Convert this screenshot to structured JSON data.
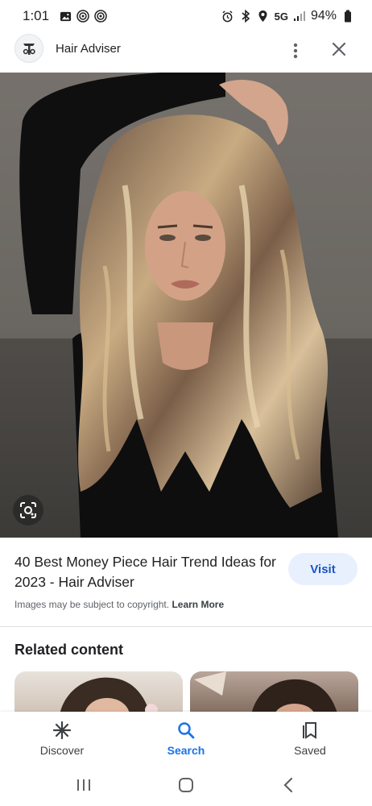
{
  "status_bar": {
    "time": "1:01",
    "network": "5G",
    "battery": "94%",
    "icons_left": [
      "image-icon",
      "nfc-icon",
      "nfc-icon"
    ],
    "icons_right": [
      "alarm-icon",
      "bluetooth-icon",
      "location-icon",
      "signal-icon",
      "battery-icon"
    ]
  },
  "header": {
    "site_name": "Hair Adviser",
    "logo_icon": "site-logo-icon",
    "more_icon": "more-vert-icon",
    "close_icon": "close-icon"
  },
  "hero": {
    "lens_icon": "lens-icon"
  },
  "result": {
    "title": "40 Best Money Piece Hair Trend Ideas for 2023 - Hair Adviser",
    "visit_label": "Visit",
    "copyright_text": "Images may be subject to copyright.",
    "learn_more": "Learn More"
  },
  "related": {
    "title": "Related content"
  },
  "bottom_nav": {
    "items": [
      {
        "label": "Discover",
        "icon": "asterisk-icon"
      },
      {
        "label": "Search",
        "icon": "search-icon",
        "active": true
      },
      {
        "label": "Saved",
        "icon": "bookmark-icon"
      }
    ]
  },
  "colors": {
    "accent": "#1a73e8",
    "visit_bg": "#e8f0fe",
    "visit_text": "#1a56c4"
  }
}
